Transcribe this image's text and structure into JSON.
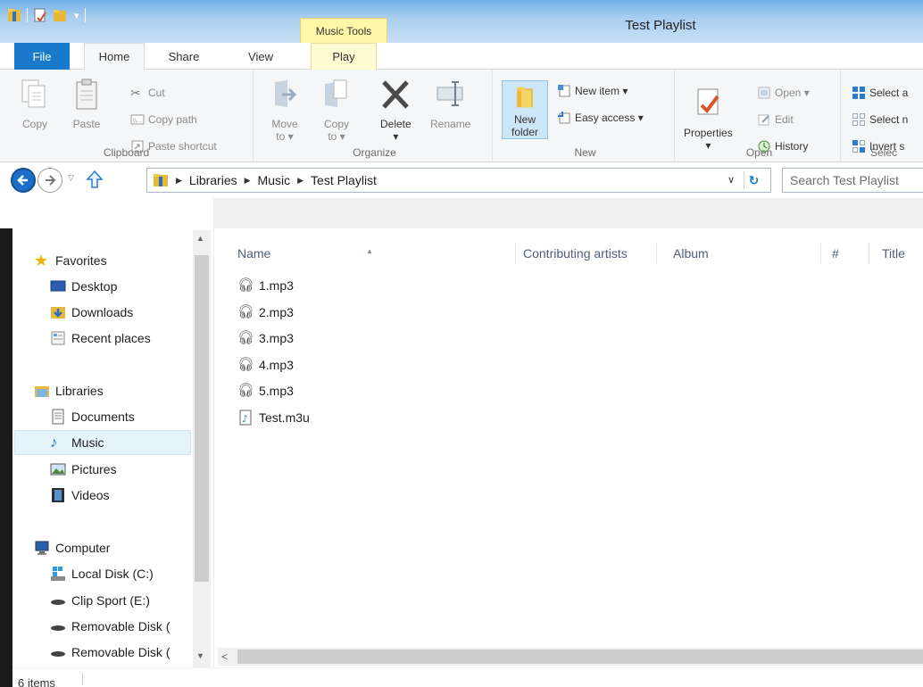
{
  "window": {
    "title": "Test Playlist",
    "contextual_tab": "Music Tools"
  },
  "ribbon_tabs": {
    "file": "File",
    "home": "Home",
    "share": "Share",
    "view": "View",
    "play": "Play"
  },
  "clipboard": {
    "group_label": "Clipboard",
    "copy": "Copy",
    "paste": "Paste",
    "cut": "Cut",
    "copy_path": "Copy path",
    "paste_shortcut": "Paste shortcut"
  },
  "organize": {
    "group_label": "Organize",
    "move_to": "Move",
    "move_to_2": "to ▾",
    "copy_to": "Copy",
    "copy_to_2": "to ▾",
    "delete": "Delete",
    "delete_2": "▾",
    "rename": "Rename"
  },
  "new": {
    "group_label": "New",
    "new_folder": "New",
    "new_folder_2": "folder",
    "new_item": "New item ▾",
    "easy_access": "Easy access ▾"
  },
  "open": {
    "group_label": "Open",
    "properties": "Properties",
    "properties_2": "▾",
    "open": "Open ▾",
    "edit": "Edit",
    "history": "History"
  },
  "select": {
    "group_label": "Selec",
    "select_all": "Select a",
    "select_none": "Select n",
    "invert": "Invert s"
  },
  "address": {
    "crumbs": [
      "Libraries",
      "Music",
      "Test Playlist"
    ],
    "search_placeholder": "Search Test Playlist"
  },
  "nav": {
    "favorites": "Favorites",
    "desktop": "Desktop",
    "downloads": "Downloads",
    "recent": "Recent places",
    "libraries": "Libraries",
    "documents": "Documents",
    "music": "Music",
    "pictures": "Pictures",
    "videos": "Videos",
    "computer": "Computer",
    "local_disk": "Local Disk (C:)",
    "clip_sport": "Clip Sport (E:)",
    "removable1": "Removable Disk (",
    "removable2": "Removable Disk ("
  },
  "columns": {
    "name": "Name",
    "artists": "Contributing artists",
    "album": "Album",
    "number": "#",
    "title": "Title"
  },
  "files": [
    "1.mp3",
    "2.mp3",
    "3.mp3",
    "4.mp3",
    "5.mp3",
    "Test.m3u"
  ],
  "status": {
    "count": "6 items"
  },
  "colors": {
    "accent": "#1979ca",
    "contextual_tab": "#fff7a8",
    "selected_nav": "#e5f3fb"
  }
}
